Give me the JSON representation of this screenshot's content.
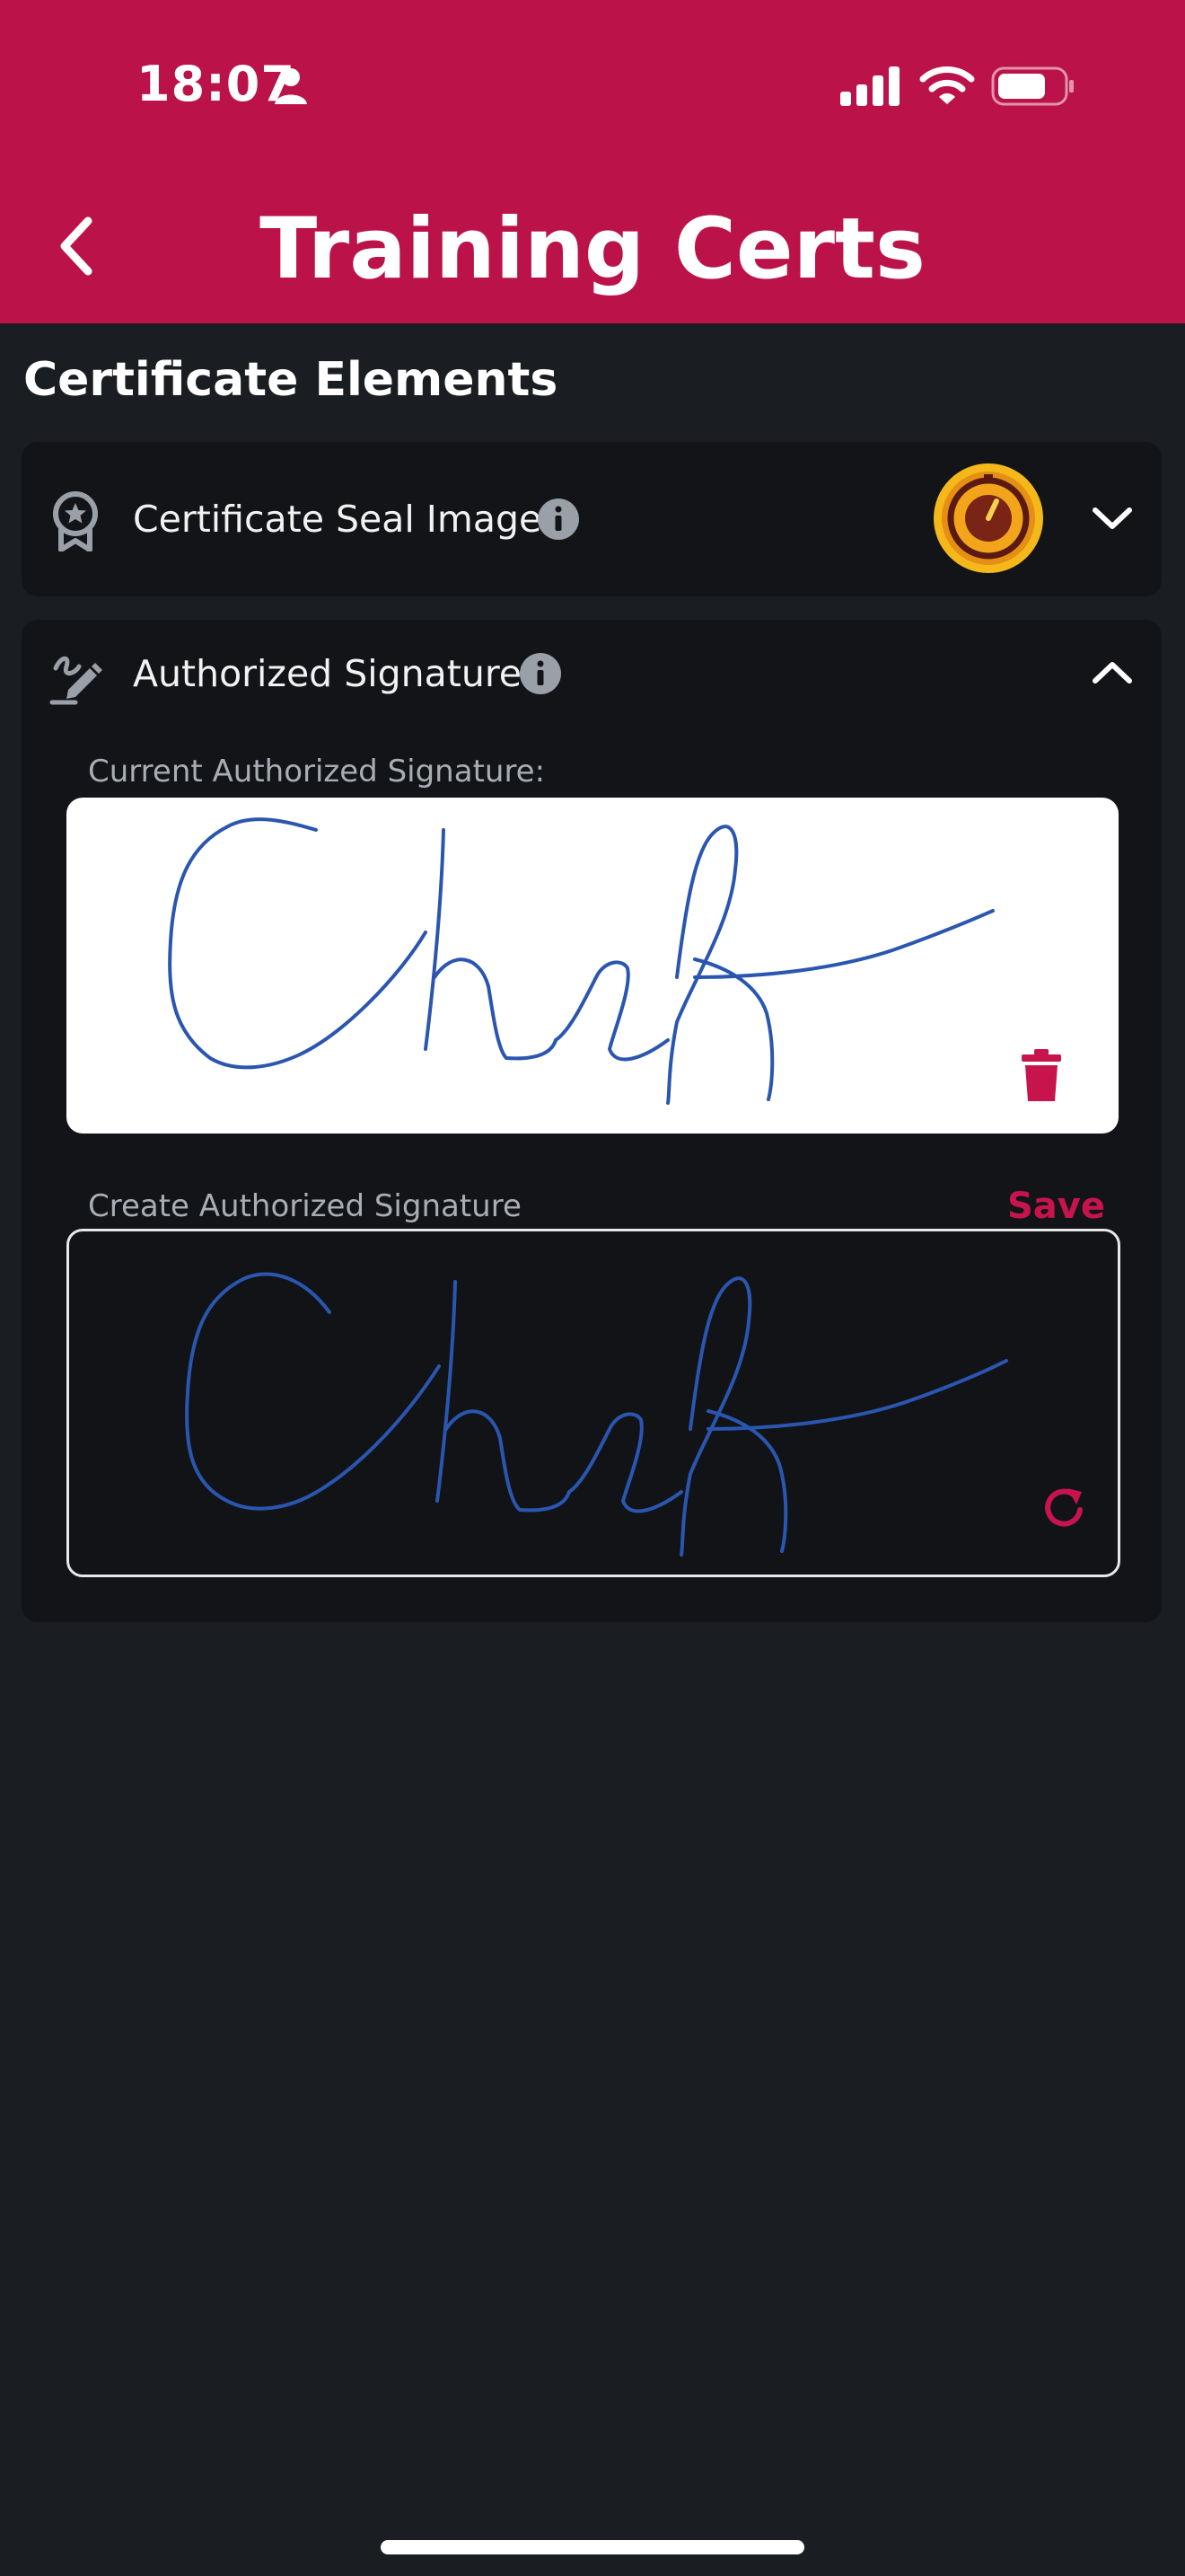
{
  "status_bar": {
    "time": "18:07"
  },
  "header": {
    "title": "Training Certs"
  },
  "section": {
    "title": "Certificate Elements"
  },
  "seal": {
    "label": "Certificate Seal Image"
  },
  "signature": {
    "label": "Authorized Signature",
    "current_label": "Current Authorized Signature:",
    "create_label": "Create Authorized Signature",
    "save_label": "Save"
  },
  "colors": {
    "accent": "#bb1249",
    "background": "#1a1d22",
    "card": "#121418",
    "signature_ink": "#2b56b0"
  },
  "icons": {
    "back": "chevron-left-icon",
    "seal_row": "award-badge-icon",
    "signature_row": "signature-pen-icon",
    "info": "info-icon",
    "collapse": "chevron-up-icon",
    "expand": "chevron-down-icon",
    "delete": "trash-icon",
    "reset": "redo-icon"
  }
}
